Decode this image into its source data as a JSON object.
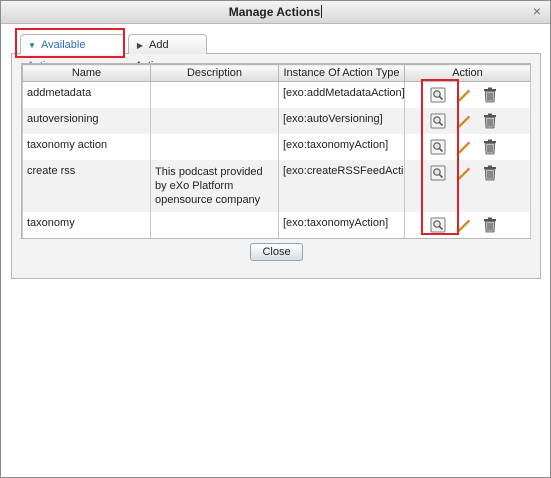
{
  "window": {
    "title": "Manage Actions"
  },
  "tabs": [
    {
      "label": "Available Actions",
      "active": true
    },
    {
      "label": "Add Action",
      "active": false
    }
  ],
  "table": {
    "headers": [
      "Name",
      "Description",
      "Instance Of Action Type",
      "Action"
    ],
    "rows": [
      {
        "name": "addmetadata",
        "description": "",
        "type": "[exo:addMetadataAction]"
      },
      {
        "name": "autoversioning",
        "description": "",
        "type": "[exo:autoVersioning]"
      },
      {
        "name": "taxonomy action",
        "description": "",
        "type": "[exo:taxonomyAction]"
      },
      {
        "name": "create rss",
        "description": "This podcast provided by eXo Platform opensource company",
        "type": "[exo:createRSSFeedActio"
      },
      {
        "name": "taxonomy",
        "description": "",
        "type": "[exo:taxonomyAction]"
      }
    ]
  },
  "row_icons": [
    "view-icon",
    "edit-pencil-icon",
    "delete-trash-icon"
  ],
  "buttons": {
    "close": "Close"
  },
  "colors": {
    "highlight": "#e0202a",
    "active_tab_text": "#2f6fb7"
  }
}
